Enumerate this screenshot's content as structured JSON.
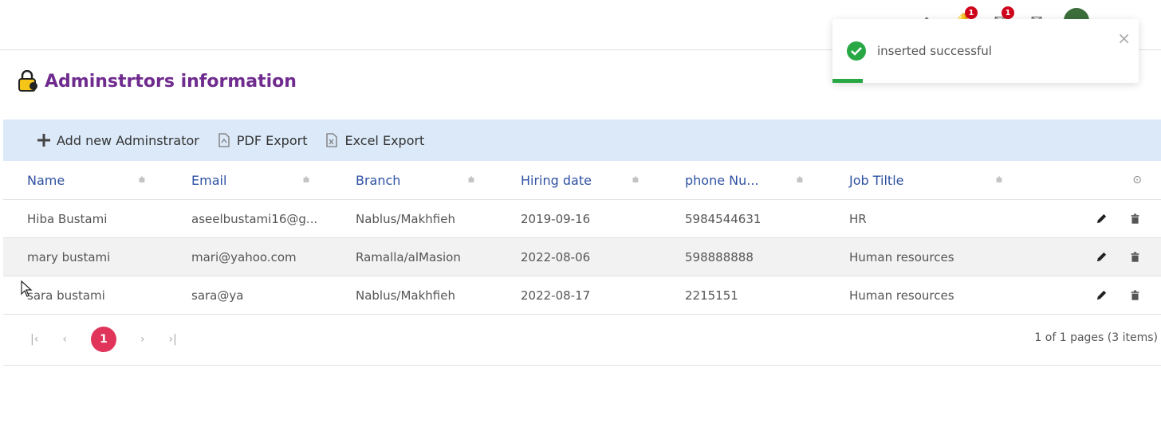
{
  "page": {
    "title": "Adminstrtors information"
  },
  "toolbar": {
    "add_label": "Add new Adminstrator",
    "pdf_label": "PDF Export",
    "excel_label": "Excel Export"
  },
  "topbar": {
    "icons": [
      {
        "name": "home-icon"
      },
      {
        "name": "notifications-icon",
        "badge": "1"
      },
      {
        "name": "messages-icon",
        "badge": "1"
      },
      {
        "name": "mail-icon"
      },
      {
        "name": "avatar"
      }
    ]
  },
  "grid": {
    "columns": [
      "Name",
      "Email",
      "Branch",
      "Hiring date",
      "phone Nu...",
      "Job Tiltle"
    ],
    "rows": [
      {
        "name": "Hiba Bustami",
        "email": "aseelbustami16@g...",
        "branch": "Nablus/Makhfieh",
        "date": "2019-09-16",
        "phone": "5984544631",
        "job": "HR"
      },
      {
        "name": "mary bustami",
        "email": "mari@yahoo.com",
        "branch": "Ramalla/alMasion",
        "date": "2022-08-06",
        "phone": "598888888",
        "job": "Human resources"
      },
      {
        "name": "sara bustami",
        "email": "sara@ya",
        "branch": "Nablus/Makhfieh",
        "date": "2022-08-17",
        "phone": "2215151",
        "job": "Human resources"
      }
    ]
  },
  "pager": {
    "current_page": "1",
    "info": "1 of 1 pages (3 items)"
  },
  "toast": {
    "message": "inserted successful",
    "close_label": "×",
    "progress": 0.1,
    "color": "#28a745"
  },
  "colors": {
    "title": "#6f2b8e",
    "header_text": "#2e51a3",
    "toolbar_bg": "#dbe9f8",
    "page_badge": "#e0345b"
  }
}
